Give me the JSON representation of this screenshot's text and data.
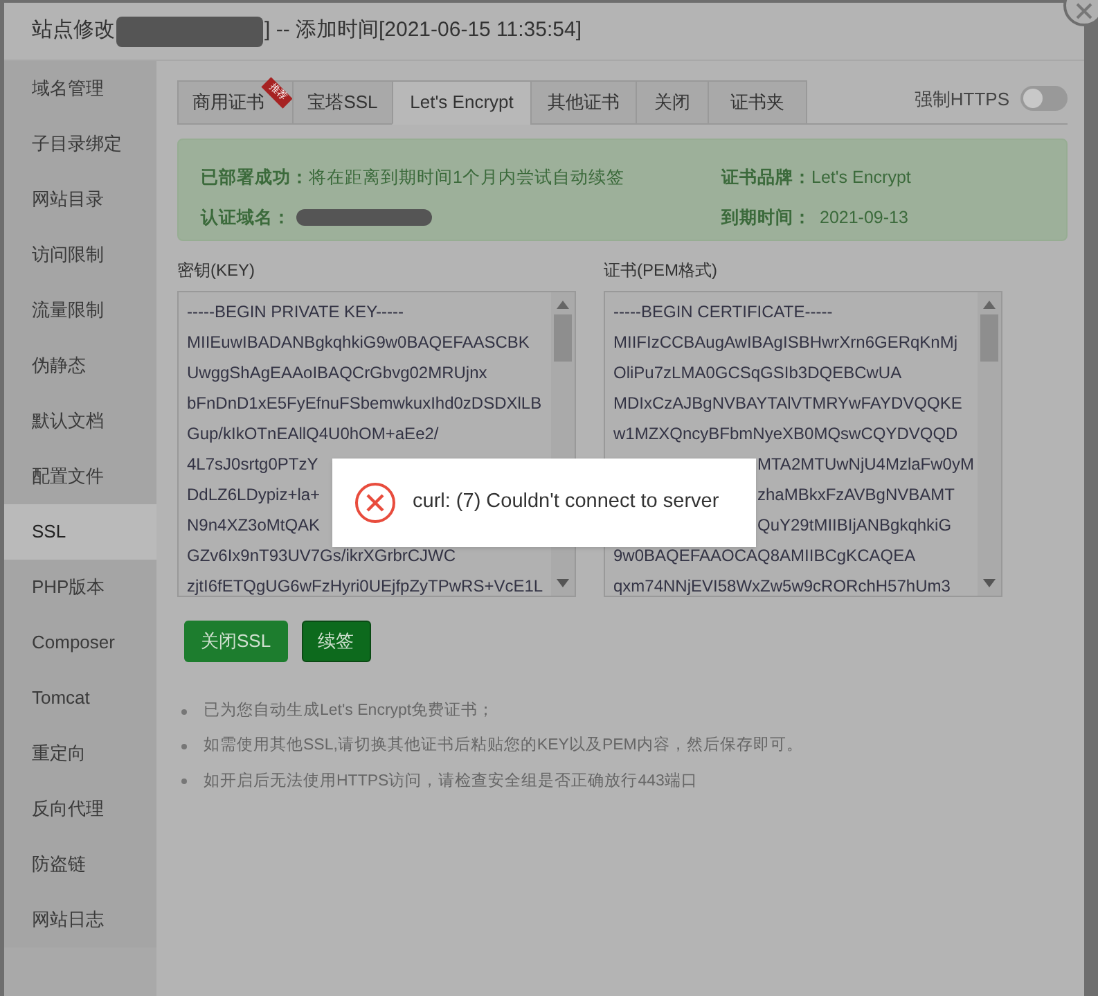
{
  "window": {
    "title_prefix": "站点修改",
    "title_suffix": "] -- 添加时间[2021-06-15 11:35:54]"
  },
  "sidebar": {
    "items": [
      {
        "label": "域名管理",
        "selected": false
      },
      {
        "label": "子目录绑定",
        "selected": false
      },
      {
        "label": "网站目录",
        "selected": false
      },
      {
        "label": "访问限制",
        "selected": false
      },
      {
        "label": "流量限制",
        "selected": false
      },
      {
        "label": "伪静态",
        "selected": false
      },
      {
        "label": "默认文档",
        "selected": false
      },
      {
        "label": "配置文件",
        "selected": false
      },
      {
        "label": "SSL",
        "selected": true
      },
      {
        "label": "PHP版本",
        "selected": false
      },
      {
        "label": "Composer",
        "selected": false
      },
      {
        "label": "Tomcat",
        "selected": false
      },
      {
        "label": "重定向",
        "selected": false
      },
      {
        "label": "反向代理",
        "selected": false
      },
      {
        "label": "防盗链",
        "selected": false
      },
      {
        "label": "网站日志",
        "selected": false
      }
    ]
  },
  "tabs": [
    {
      "label": "商用证书",
      "selected": false,
      "badge": "推荐"
    },
    {
      "label": "宝塔SSL",
      "selected": false
    },
    {
      "label": "Let's Encrypt",
      "selected": true
    },
    {
      "label": "其他证书",
      "selected": false
    },
    {
      "label": "关闭",
      "selected": false
    },
    {
      "label": "证书夹",
      "selected": false
    }
  ],
  "force_https": {
    "label": "强制HTTPS",
    "on": false
  },
  "status": {
    "deployed_label": "已部署成功：",
    "deployed_text": "将在距离到期时间1个月内尝试自动续签",
    "domain_label": "认证域名：",
    "brand_label": "证书品牌：",
    "brand_value": "Let's Encrypt",
    "expiry_label": "到期时间：",
    "expiry_value": "2021-09-13"
  },
  "key": {
    "label": "密钥(KEY)",
    "lines": [
      "-----BEGIN PRIVATE KEY-----",
      "MIIEuwIBADANBgkqhkiG9w0BAQEFAASCBK",
      "UwggShAgEAAoIBAQCrGbvg02MRUjnx",
      "bFnDnD1xE5FyEfnuFSbemwkuxIhd0zDSDXlLB",
      "Gup/kIkOTnEAllQ4U0hOM+aEe2/",
      "4L7sJ0srtg0PTzY",
      "DdLZ6LDypiz+la+",
      "N9n4XZ3oMtQAK",
      "GZv6Ix9nT93UV7Gs/ikrXGrbrCJWC",
      "zjtI6fETQgUG6wFzHyri0UEjfpZyTPwRS+VcE1L"
    ]
  },
  "certificate": {
    "label": "证书(PEM格式)",
    "lines": [
      "-----BEGIN CERTIFICATE-----",
      "MIIFIzCCBAugAwIBAgISBHwrXrn6GERqKnMj",
      "OliPu7zLMA0GCSqGSIb3DQEBCwUA",
      "MDIxCzAJBgNVBAYTAlVTMRYwFAYDVQQKE",
      "w1MZXQncyBFbmNyeXB0MQswCQYDVQQD",
      {
        "text": "MTA2MTUwNjU4MzlaFw0yM",
        "kind": "behind_toast"
      },
      {
        "text": "zhaMBkxFzAVBgNVBAMT",
        "kind": "behind_toast"
      },
      {
        "text": "QuY29tMIIBIjANBgkqhkiG",
        "kind": "behind_toast"
      },
      "9w0BAQEFAAOCAQ8AMIIBCgKCAQEA",
      "qxm74NNjEVI58WxZw5w9cRORchH57hUm3"
    ]
  },
  "buttons": [
    {
      "label": "关闭SSL",
      "kind": "primary"
    },
    {
      "label": "续签",
      "kind": "outlined"
    }
  ],
  "notes": [
    "已为您自动生成Let's Encrypt免费证书；",
    "如需使用其他SSL,请切换其他证书后粘贴您的KEY以及PEM内容，然后保存即可。",
    "如开启后无法使用HTTPS访问，请检查安全组是否正确放行443端口"
  ],
  "toast": {
    "message": "curl: (7) Couldn't connect to server"
  }
}
